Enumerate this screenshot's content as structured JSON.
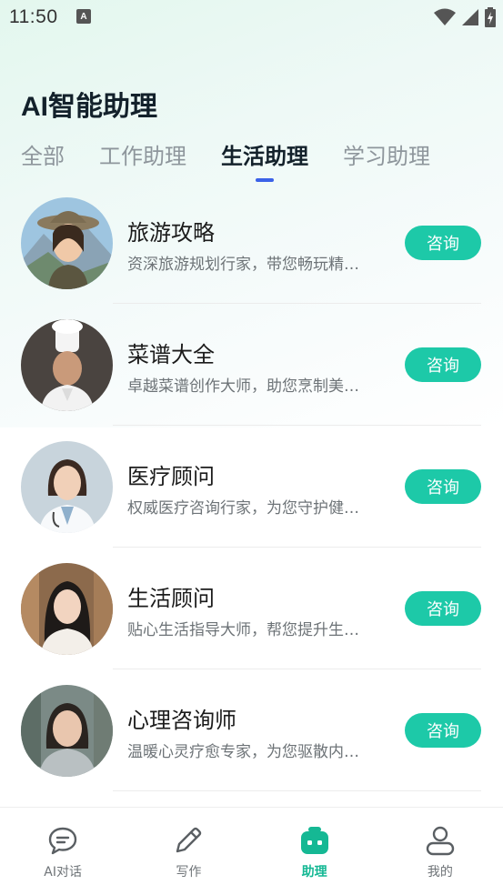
{
  "status_bar": {
    "time": "11:50",
    "notification_icon": "A"
  },
  "page": {
    "title": "AI智能助理"
  },
  "tabs": [
    {
      "label": "全部",
      "active": false
    },
    {
      "label": "工作助理",
      "active": false
    },
    {
      "label": "生活助理",
      "active": true
    },
    {
      "label": "学习助理",
      "active": false
    }
  ],
  "assistants": [
    {
      "name": "旅游攻略",
      "desc": "资深旅游规划行家，带您畅玩精…",
      "button": "咨询",
      "avatar_icon": "traveler-avatar"
    },
    {
      "name": "菜谱大全",
      "desc": "卓越菜谱创作大师，助您烹制美…",
      "button": "咨询",
      "avatar_icon": "chef-avatar"
    },
    {
      "name": "医疗顾问",
      "desc": "权威医疗咨询行家，为您守护健…",
      "button": "咨询",
      "avatar_icon": "doctor-avatar"
    },
    {
      "name": "生活顾问",
      "desc": "贴心生活指导大师，帮您提升生…",
      "button": "咨询",
      "avatar_icon": "life-advisor-avatar"
    },
    {
      "name": "心理咨询师",
      "desc": "温暖心灵疗愈专家，为您驱散内…",
      "button": "咨询",
      "avatar_icon": "psychologist-avatar"
    }
  ],
  "bottom_nav": [
    {
      "label": "AI对话",
      "icon": "chat-bubble-icon",
      "active": false
    },
    {
      "label": "写作",
      "icon": "pencil-icon",
      "active": false
    },
    {
      "label": "助理",
      "icon": "robot-icon",
      "active": true
    },
    {
      "label": "我的",
      "icon": "user-icon",
      "active": false
    }
  ],
  "colors": {
    "accent": "#1dc9a8",
    "tab_indicator": "#3b62e8",
    "active_nav": "#15b894"
  }
}
